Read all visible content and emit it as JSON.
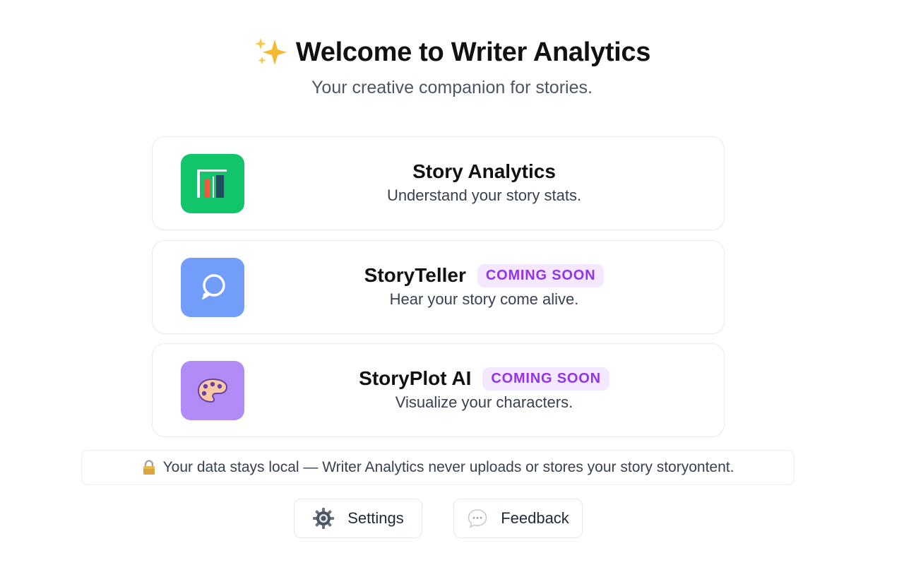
{
  "header": {
    "title": "Welcome to Writer Analytics",
    "subtitle": "Your creative companion for stories.",
    "icon": "sparkles-icon"
  },
  "cards": [
    {
      "title": "Story Analytics",
      "description": "Understand your story stats.",
      "badge": "",
      "icon": "bar-chart-icon",
      "color": "#12c46a"
    },
    {
      "title": "StoryTeller",
      "description": "Hear your story come alive.",
      "badge": "COMING SOON",
      "icon": "speech-bubble-icon",
      "color": "#739dfb"
    },
    {
      "title": "StoryPlot AI",
      "description": "Visualize your characters.",
      "badge": "COMING SOON",
      "icon": "palette-icon",
      "color": "#b18bf6"
    }
  ],
  "privacy": {
    "text": "Your data stays local — Writer Analytics never uploads or stores your story storyontent.",
    "icon": "lock-icon"
  },
  "footer": {
    "settings_label": "Settings",
    "feedback_label": "Feedback",
    "settings_icon": "gear-icon",
    "feedback_icon": "chat-icon"
  },
  "colors": {
    "badge_bg": "#f3e8ff",
    "badge_text": "#9333ea"
  }
}
